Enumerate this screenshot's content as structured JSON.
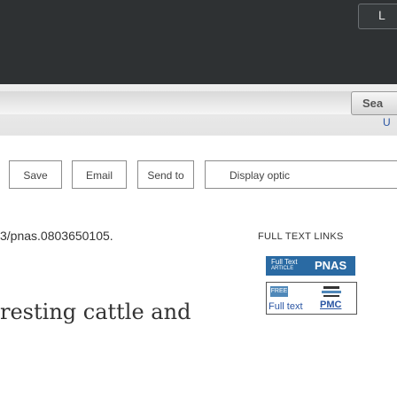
{
  "header": {
    "login_label": "L"
  },
  "search": {
    "button_label": "Sea",
    "user_guide_label": "U"
  },
  "actions": {
    "save_label": "Save",
    "email_label": "Email",
    "send_to_label": "Send to",
    "display_options_label": "Display optic"
  },
  "article": {
    "doi_text": "3/pnas.0803650105.",
    "title_fragment": "resting cattle and"
  },
  "full_text_links": {
    "label": "FULL TEXT LINKS",
    "pnas": {
      "full_text_label": "Full Text",
      "article_label": "ARTICLE",
      "brand_label": "PNAS"
    },
    "pmc": {
      "free_label": "FREE",
      "full_text_label": "Full text",
      "brand_label": "PMC"
    }
  },
  "colors": {
    "banner": "#2e3133",
    "link": "#2a55a3",
    "pnas_blue": "#2a6aa3"
  }
}
